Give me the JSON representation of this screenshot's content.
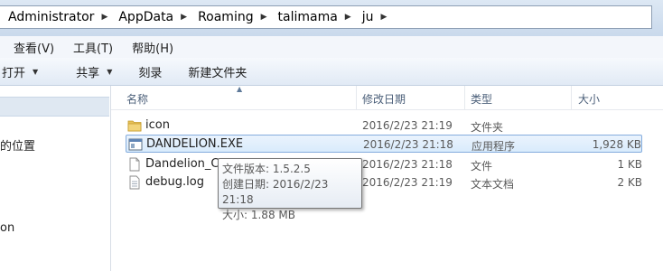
{
  "breadcrumbs": [
    "Administrator",
    "AppData",
    "Roaming",
    "talimama",
    "ju"
  ],
  "menu": [
    "查看(V)",
    "工具(T)",
    "帮助(H)"
  ],
  "toolbar": {
    "open_label": "打开",
    "share_label": "共享",
    "burn_label": "刻录",
    "new_folder_label": "新建文件夹"
  },
  "nav": {
    "item_places": "的位置",
    "item_lon": "on"
  },
  "columns": {
    "name": "名称",
    "modified": "修改日期",
    "type": "类型",
    "size": "大小"
  },
  "files": [
    {
      "name": "icon",
      "modified": "2016/2/23 21:19",
      "type": "文件夹",
      "size": "",
      "icon": "folder-icon"
    },
    {
      "name": "DANDELION.EXE",
      "modified": "2016/2/23 21:18",
      "type": "应用程序",
      "size": "1,928 KB",
      "icon": "exe-icon"
    },
    {
      "name": "Dandelion_Co",
      "modified": "2016/2/23 21:18",
      "type": "文件",
      "size": "1 KB",
      "icon": "file-icon"
    },
    {
      "name": "debug.log",
      "modified": "2016/2/23 21:19",
      "type": "文本文档",
      "size": "2 KB",
      "icon": "text-file-icon"
    }
  ],
  "tooltip": {
    "line1": "文件版本: 1.5.2.5",
    "line2": "创建日期: 2016/2/23 21:18",
    "line3": "大小: 1.88 MB"
  },
  "colors": {
    "selection_border": "#84acdd",
    "selection_fill": "#d9ebfc",
    "folder": "#e8c25a"
  }
}
